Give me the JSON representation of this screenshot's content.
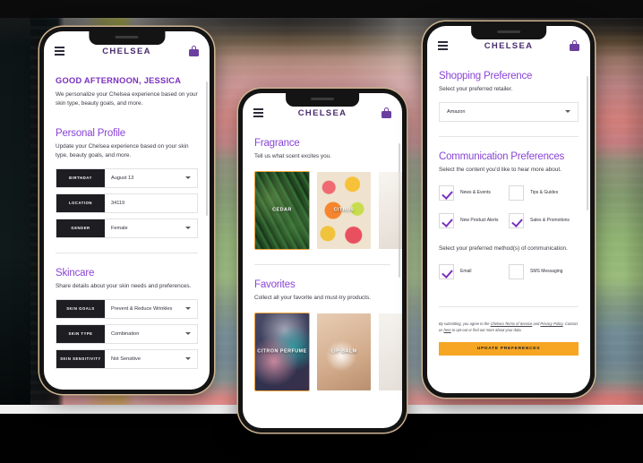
{
  "app": {
    "brand": "CHELSEA"
  },
  "icons": {
    "menu": "hamburger-icon",
    "bag": "shopping-bag-icon",
    "caret": "chevron-down-icon",
    "check": "checkmark-icon"
  },
  "colors": {
    "accent_purple": "#8a45d6",
    "brand_purple": "#7b2fbe",
    "header_purple": "#4a2c6d",
    "cta_orange": "#f6a623",
    "selected_border": "#f2a33c",
    "label_dark": "#1d1d22"
  },
  "phone_left": {
    "greeting": "GOOD AFTERNOON, JESSICA",
    "intro": "We personalize your Chelsea experience based on your skin type, beauty goals, and more.",
    "personal_profile": {
      "title": "Personal Profile",
      "subtitle": "Update your Chelsea experience based on your skin type, beauty goals, and more.",
      "fields": [
        {
          "label": "BIRTHDAY",
          "value": "August   13",
          "has_caret": true
        },
        {
          "label": "LOCATION",
          "value": "34119",
          "has_caret": false
        },
        {
          "label": "GENDER",
          "value": "Female",
          "has_caret": true
        }
      ]
    },
    "skincare": {
      "title": "Skincare",
      "subtitle": "Share details about your skin needs and preferences.",
      "fields": [
        {
          "label": "SKIN GOALS",
          "value": "Prevent & Reduce Wrinkles",
          "has_caret": true
        },
        {
          "label": "SKIN TYPE",
          "value": "Combination",
          "has_caret": true
        },
        {
          "label": "SKIN SENSITIVITY",
          "value": "Not Sensitive",
          "has_caret": true
        }
      ]
    }
  },
  "phone_center": {
    "fragrance": {
      "title": "Fragrance",
      "subtitle": "Tell us what scent excites you.",
      "cards": [
        {
          "caption": "CEDAR",
          "art": "art-cedar",
          "selected": true
        },
        {
          "caption": "CITRUS",
          "art": "art-citrus",
          "selected": false
        },
        {
          "caption": "",
          "art": "art-neutral",
          "selected": false
        }
      ]
    },
    "favorites": {
      "title": "Favorites",
      "subtitle": "Collect all your favorite and must-try products.",
      "cards": [
        {
          "caption": "CITRON PERFUME",
          "art": "art-perfume",
          "selected": true
        },
        {
          "caption": "LIP BALM",
          "art": "art-lipbalm",
          "selected": false
        },
        {
          "caption": "",
          "art": "art-soft",
          "selected": false
        }
      ]
    }
  },
  "phone_right": {
    "shopping": {
      "title": "Shopping Preference",
      "subtitle": "Select your preferred retailer.",
      "retailer": "Amazon"
    },
    "communication": {
      "title": "Communication Preferences",
      "subtitle": "Select the content you'd like to hear more about.",
      "content_options": [
        {
          "label": "News & Events",
          "checked": true
        },
        {
          "label": "Tips & Guides",
          "checked": false
        },
        {
          "label": "New Product Alerts",
          "checked": true
        },
        {
          "label": "Sales & Promotions",
          "checked": true
        }
      ],
      "method_prompt": "Select your preferred method(s) of communication.",
      "method_options": [
        {
          "label": "Email",
          "checked": true
        },
        {
          "label": "SMS Messaging",
          "checked": false
        }
      ],
      "legal_part1": "By submitting, you agree to the ",
      "legal_link1": "Chelsea Terms of Service",
      "legal_part2": " and ",
      "legal_link2": "Privacy Policy",
      "legal_part3": ". Contact us ",
      "legal_link3": "here",
      "legal_part4": " to opt-out or find out more about your data.",
      "cta_label": "UPDATE PREFERENCES"
    }
  }
}
